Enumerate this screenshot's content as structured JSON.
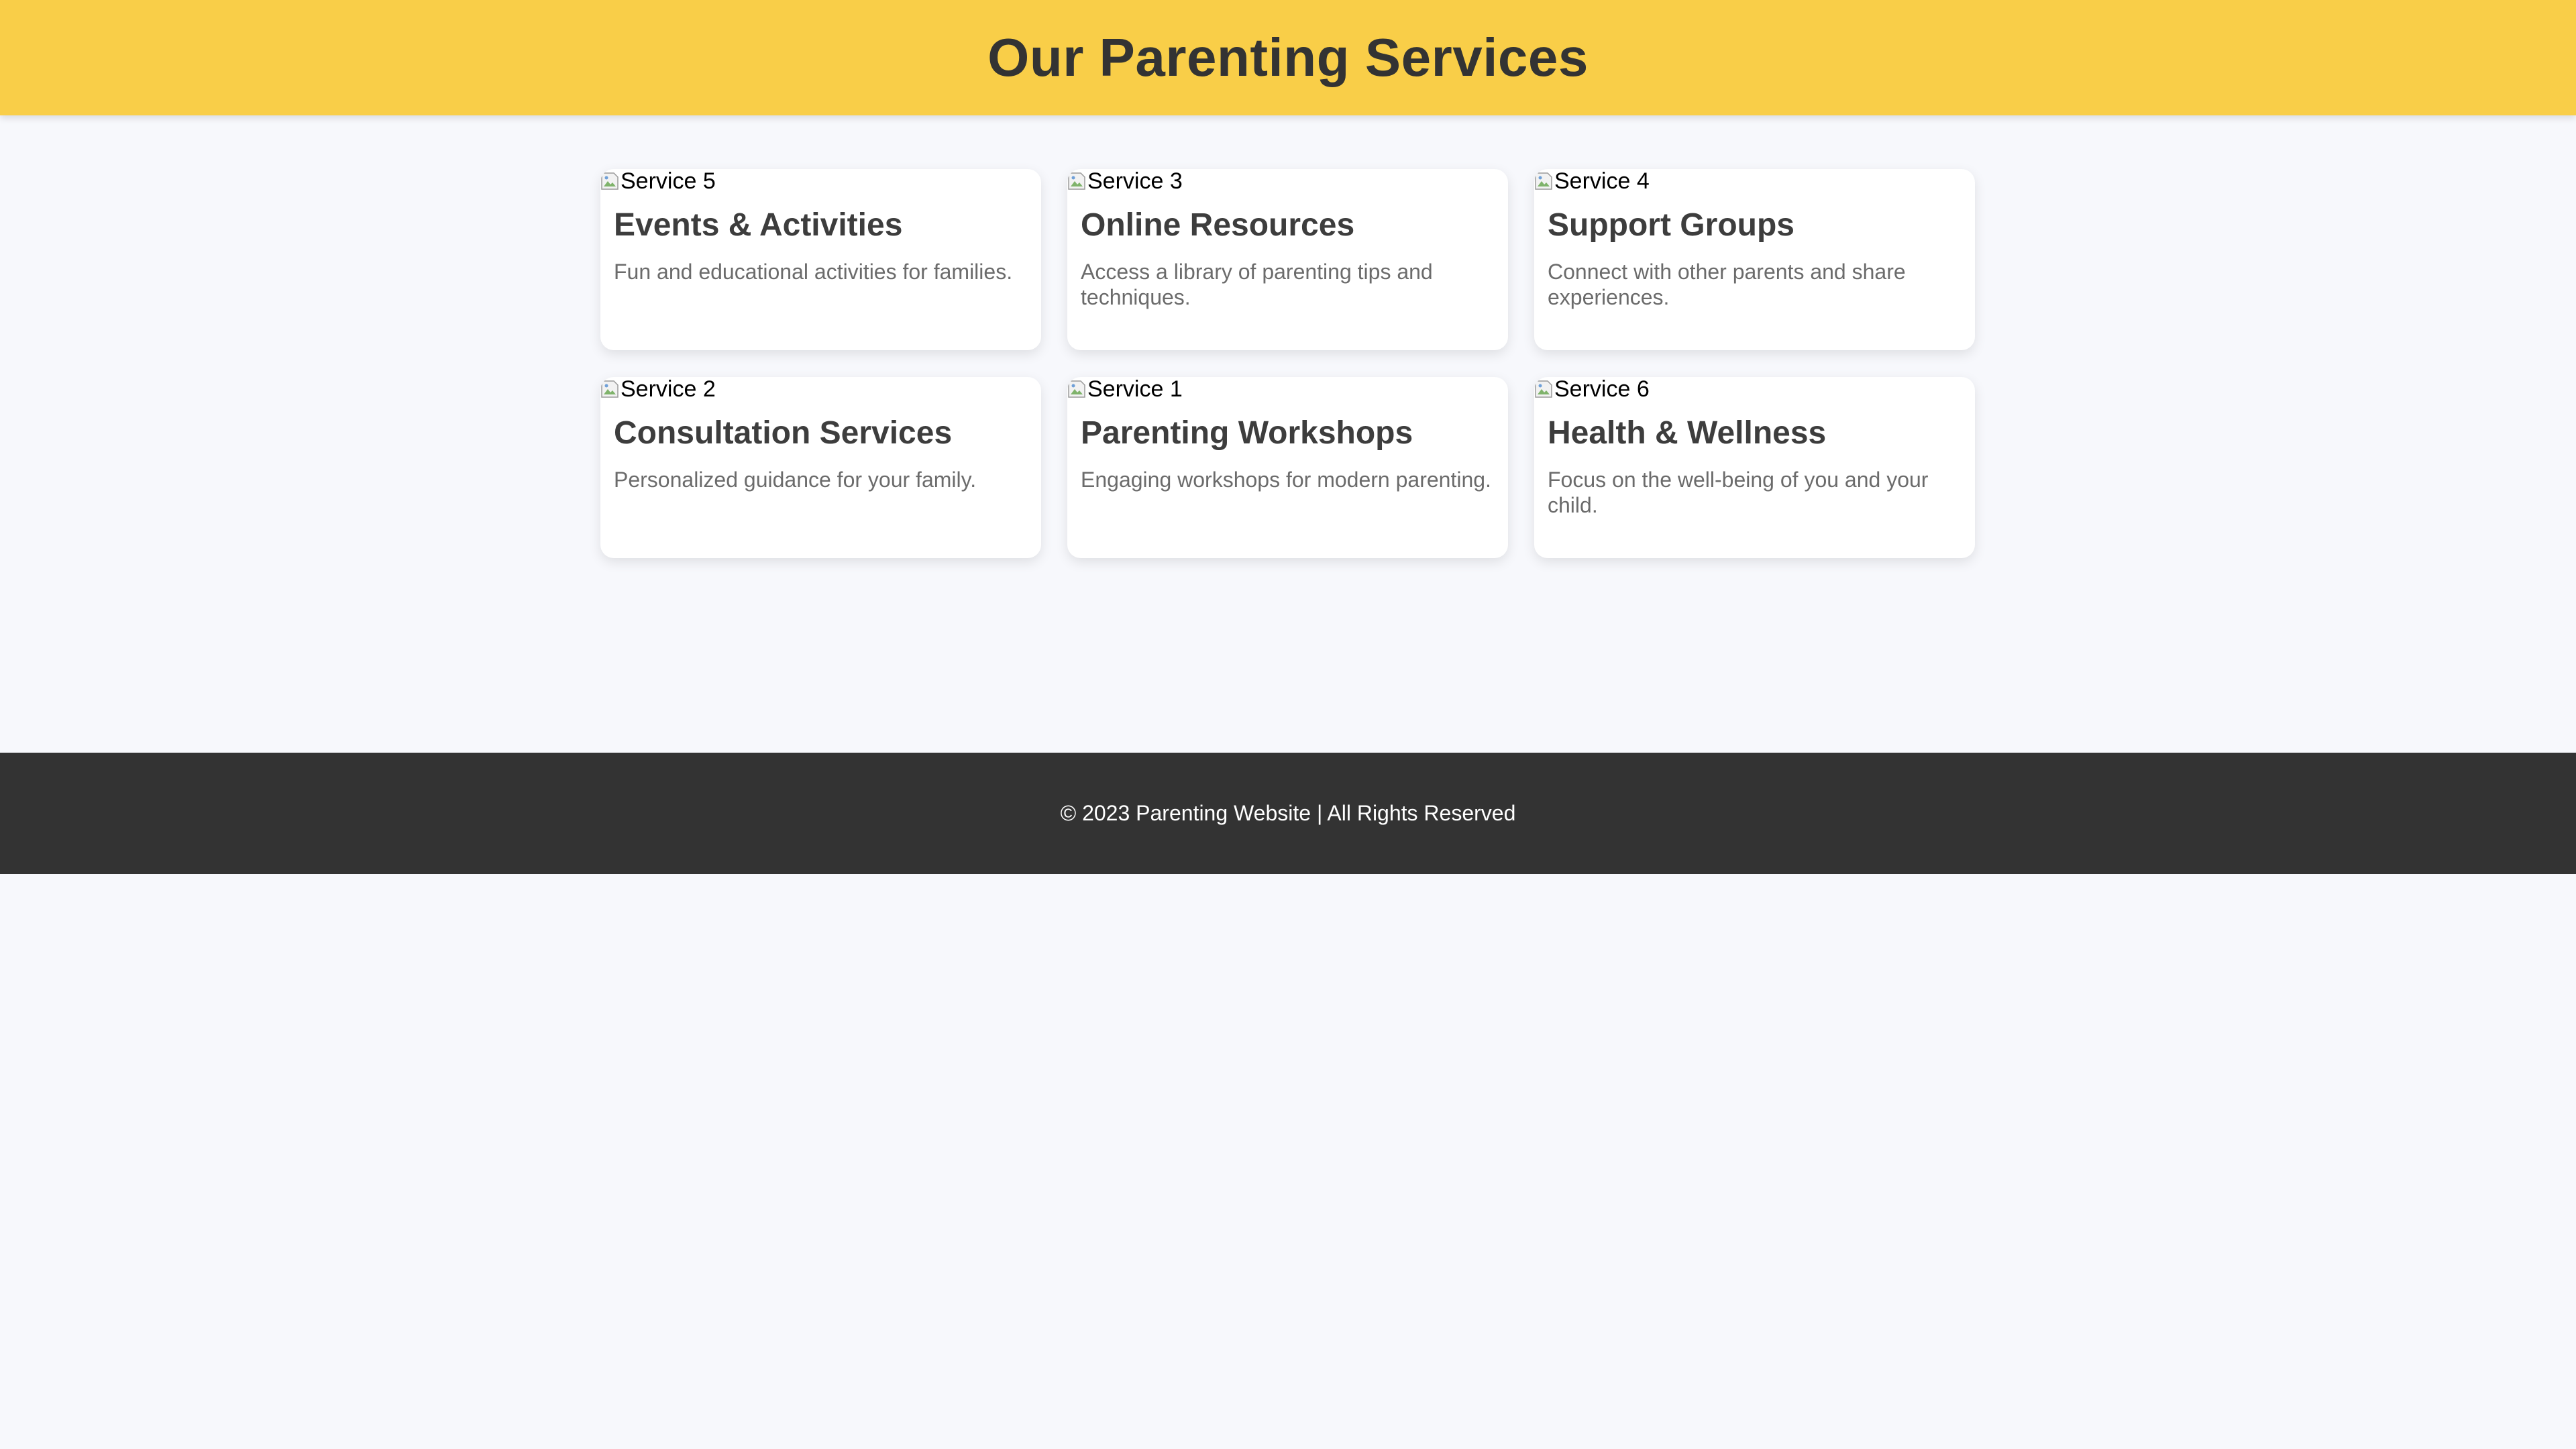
{
  "header": {
    "title": "Our Parenting Services"
  },
  "services": [
    {
      "img_alt": "Service 5",
      "title": "Events & Activities",
      "description": "Fun and educational activities for families."
    },
    {
      "img_alt": "Service 3",
      "title": "Online Resources",
      "description": "Access a library of parenting tips and techniques."
    },
    {
      "img_alt": "Service 4",
      "title": "Support Groups",
      "description": "Connect with other parents and share experiences."
    },
    {
      "img_alt": "Service 2",
      "title": "Consultation Services",
      "description": "Personalized guidance for your family."
    },
    {
      "img_alt": "Service 1",
      "title": "Parenting Workshops",
      "description": "Engaging workshops for modern parenting."
    },
    {
      "img_alt": "Service 6",
      "title": "Health & Wellness",
      "description": "Focus on the well-being of you and your child."
    }
  ],
  "footer": {
    "text": "© 2023 Parenting Website | All Rights Reserved"
  },
  "colors": {
    "header_bg": "#f9ce48",
    "page_bg": "#f7f8fc",
    "footer_bg": "#333333",
    "title_text": "#333333",
    "card_title": "#3d3d3d",
    "card_desc": "#6b6b6b"
  }
}
